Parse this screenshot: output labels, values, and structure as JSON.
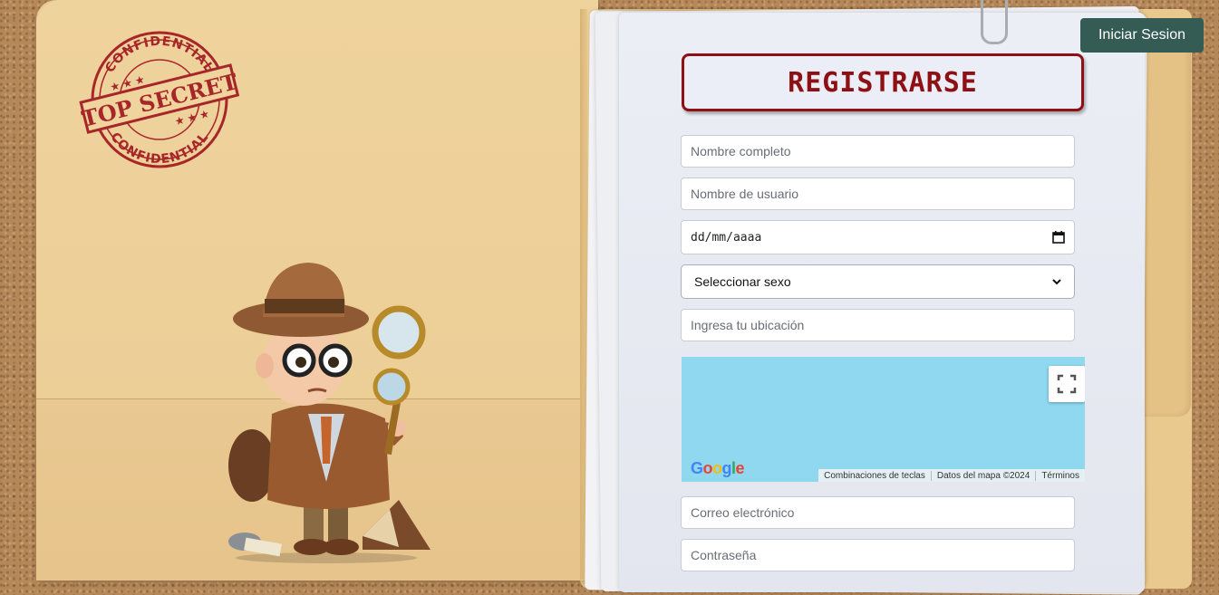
{
  "header": {
    "login_button": "Iniciar Sesion"
  },
  "stamp": {
    "top_text": "CONFIDENTIAL",
    "center_text": "TOP SECRET",
    "bottom_text": "CONFIDENTIAL"
  },
  "form": {
    "title": "REGISTRARSE",
    "full_name_placeholder": "Nombre completo",
    "username_placeholder": "Nombre de usuario",
    "date_value": "dd/mm/aaaa",
    "sex_select_value": "Seleccionar sexo",
    "location_placeholder": "Ingresa tu ubicación",
    "email_placeholder": "Correo electrónico",
    "password_placeholder": "Contraseña"
  },
  "map": {
    "logo": "Google",
    "attribution": [
      "Combinaciones de teclas",
      "Datos del mapa ©2024",
      "Términos"
    ]
  },
  "colors": {
    "brand_red": "#8e1014",
    "login_bg": "#355c54",
    "map_water": "#8fd8f0"
  },
  "icons": [
    "calendar-icon",
    "chevron-down-icon",
    "fullscreen-icon",
    "paperclip-icon",
    "magnifying-glass-icon"
  ]
}
